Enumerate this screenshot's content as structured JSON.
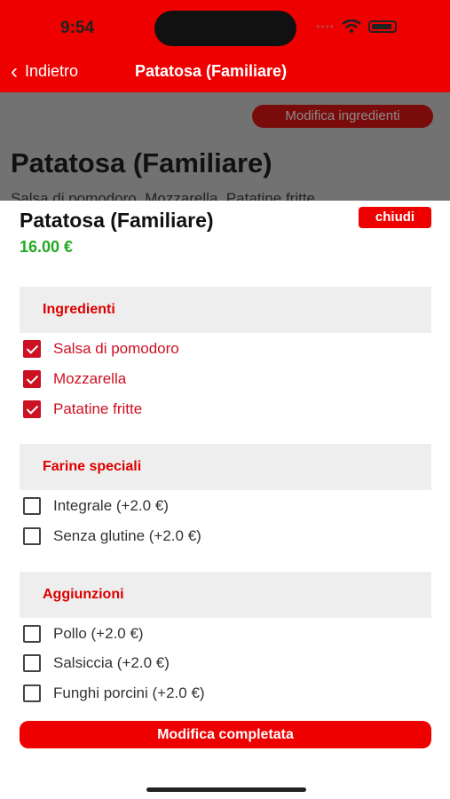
{
  "status_bar": {
    "time": "9:54"
  },
  "nav": {
    "back_label": "Indietro",
    "title": "Patatosa (Familiare)"
  },
  "background_page": {
    "edit_ingredients_label": "Modifica ingredienti",
    "title": "Patatosa (Familiare)",
    "description": "Salsa di pomodoro, Mozzarella, Patatine fritte"
  },
  "sheet": {
    "title": "Patatosa (Familiare)",
    "close_label": "chiudi",
    "price": "16.00 €",
    "sections": [
      {
        "header": "Ingredienti",
        "options": [
          {
            "label": "Salsa di pomodoro",
            "checked": true
          },
          {
            "label": "Mozzarella",
            "checked": true
          },
          {
            "label": "Patatine fritte",
            "checked": true
          }
        ]
      },
      {
        "header": "Farine speciali",
        "options": [
          {
            "label": "Integrale (+2.0 €)",
            "checked": false
          },
          {
            "label": "Senza glutine (+2.0 €)",
            "checked": false
          }
        ]
      },
      {
        "header": "Aggiunzioni",
        "options": [
          {
            "label": "Pollo (+2.0 €)",
            "checked": false
          },
          {
            "label": "Salsiccia (+2.0 €)",
            "checked": false
          },
          {
            "label": "Funghi porcini (+2.0 €)",
            "checked": false
          }
        ]
      }
    ],
    "done_label": "Modifica completata"
  },
  "colors": {
    "brand_red": "#ee0000",
    "price_green": "#22aa22",
    "checked_red": "#cc1122"
  }
}
